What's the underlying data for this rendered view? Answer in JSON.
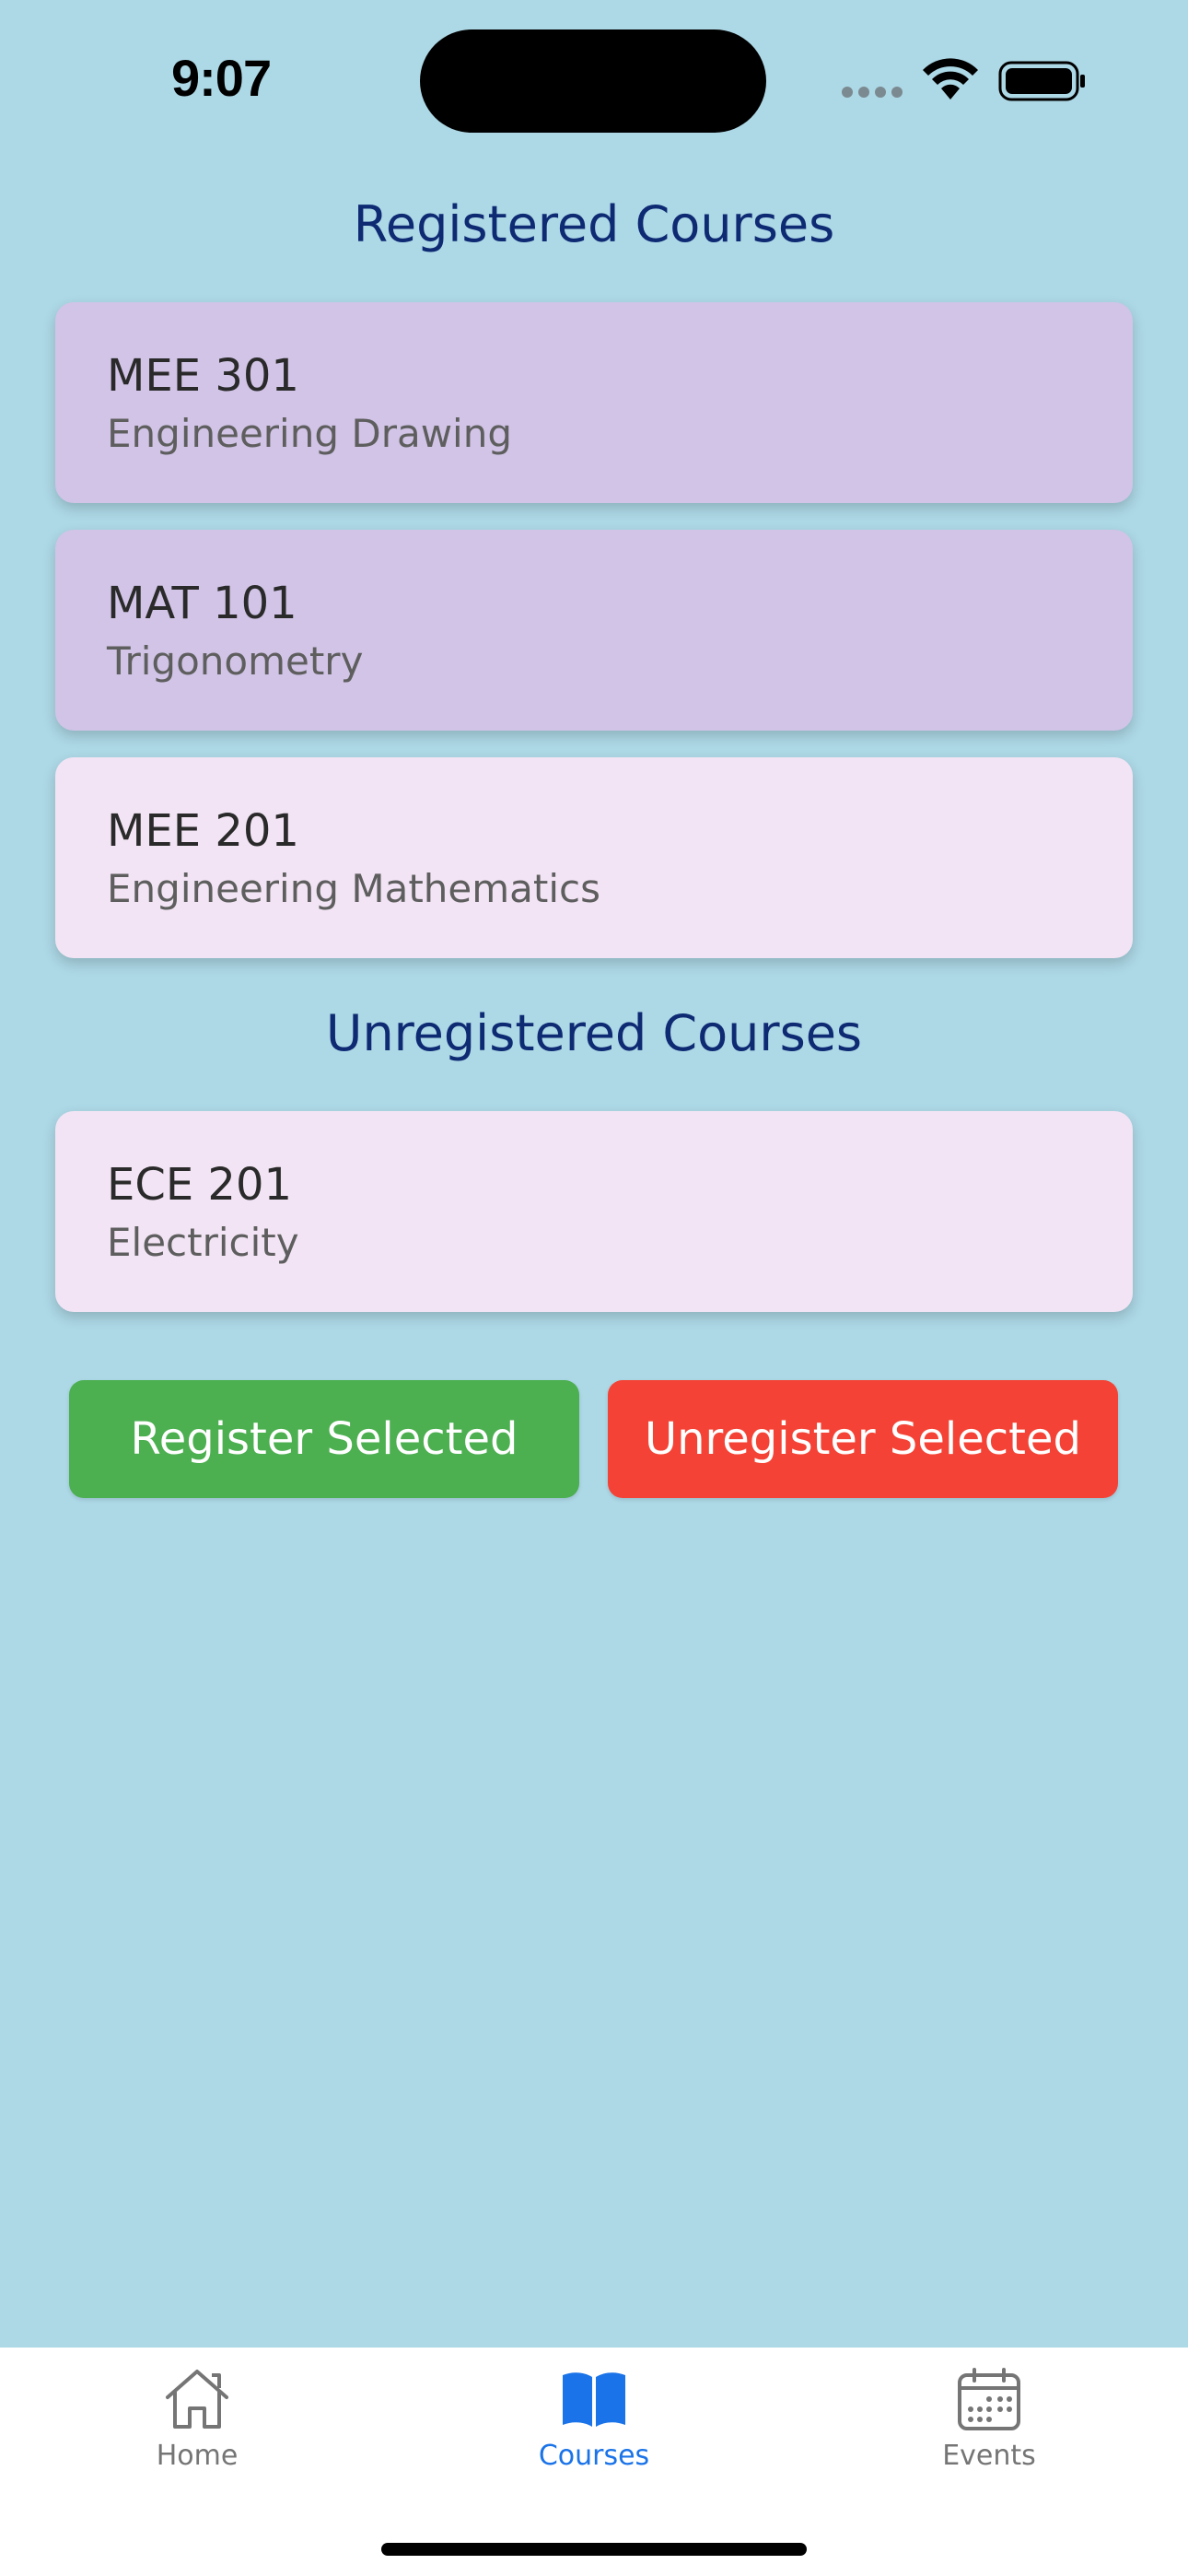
{
  "status_bar": {
    "time": "9:07"
  },
  "sections": {
    "registered_title": "Registered Courses",
    "unregistered_title": "Unregistered Courses"
  },
  "registered_courses": [
    {
      "code": "MEE 301",
      "name": "Engineering Drawing",
      "selected": true
    },
    {
      "code": "MAT 101",
      "name": "Trigonometry",
      "selected": true
    },
    {
      "code": "MEE 201",
      "name": "Engineering Mathematics",
      "selected": false
    }
  ],
  "unregistered_courses": [
    {
      "code": "ECE 201",
      "name": "Electricity",
      "selected": false
    }
  ],
  "actions": {
    "register_label": "Register Selected",
    "unregister_label": "Unregister Selected"
  },
  "bottom_nav": {
    "items": [
      {
        "label": "Home",
        "icon": "home-icon",
        "active": false
      },
      {
        "label": "Courses",
        "icon": "book-icon",
        "active": true
      },
      {
        "label": "Events",
        "icon": "calendar-icon",
        "active": false
      }
    ]
  },
  "colors": {
    "background": "#add8e6",
    "selected_card": "#d1c4e6",
    "card": "#f2e4f4",
    "heading": "#0d2a73",
    "register_button": "#4caf50",
    "unregister_button": "#f44336",
    "nav_active": "#1a73e8",
    "nav_inactive": "#757575"
  }
}
